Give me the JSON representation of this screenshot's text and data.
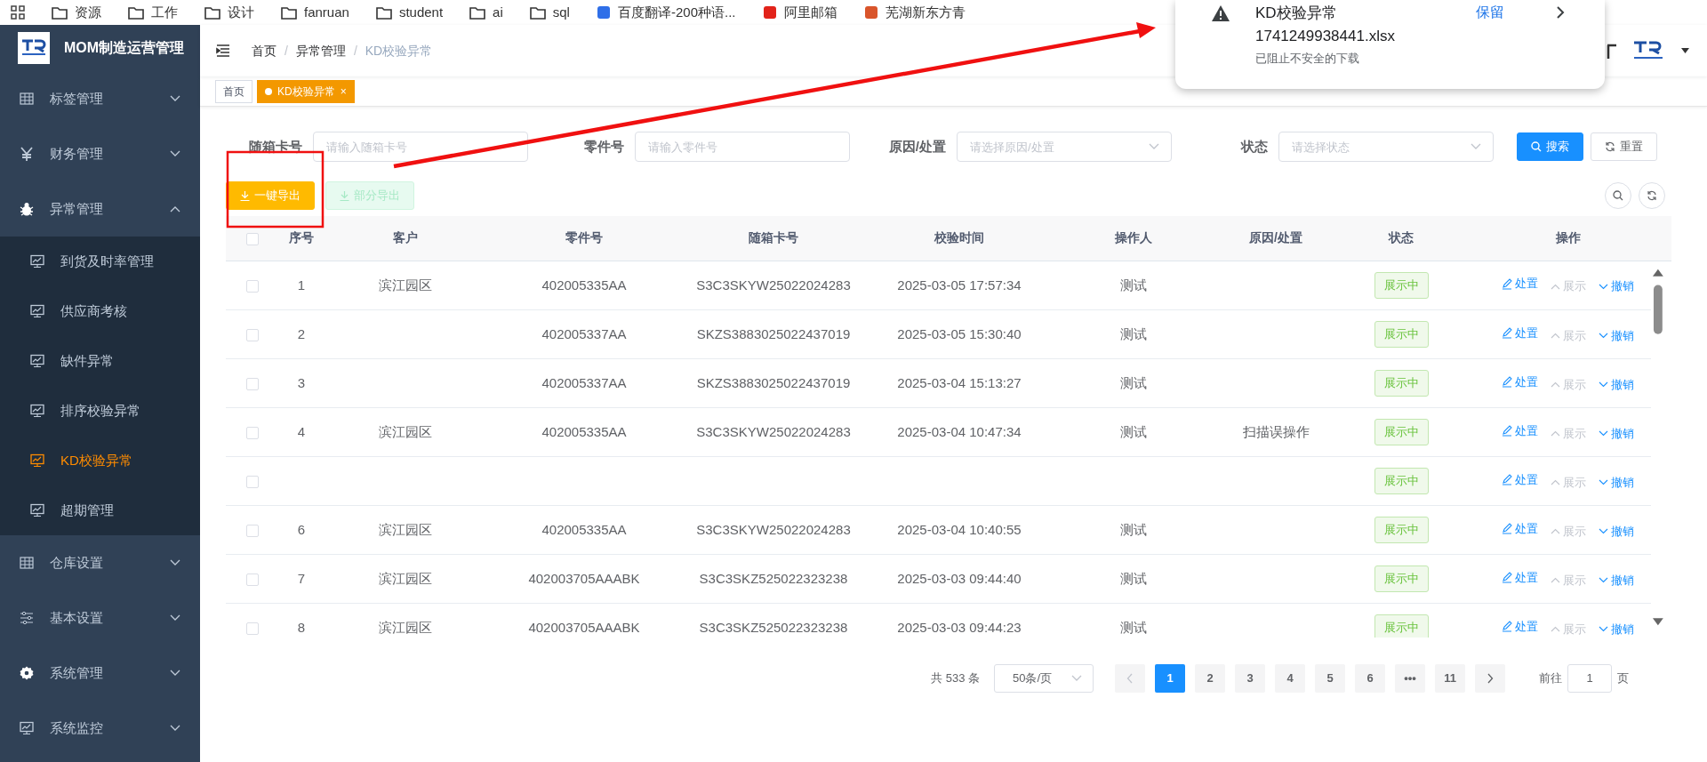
{
  "bookmarks": [
    {
      "label": "资源",
      "kind": "folder"
    },
    {
      "label": "工作",
      "kind": "folder"
    },
    {
      "label": "设计",
      "kind": "folder"
    },
    {
      "label": "fanruan",
      "kind": "folder"
    },
    {
      "label": "student",
      "kind": "folder"
    },
    {
      "label": "ai",
      "kind": "folder"
    },
    {
      "label": "sql",
      "kind": "folder"
    },
    {
      "label": "百度翻译-200种语...",
      "kind": "site",
      "color": "#2f6fe8"
    },
    {
      "label": "阿里邮箱",
      "kind": "site",
      "color": "#e2231a"
    },
    {
      "label": "芜湖新东方青",
      "kind": "site",
      "color": "#d9552b"
    }
  ],
  "download_popup": {
    "title": "KD校验异常",
    "filename": "1741249938441.xlsx",
    "note": "已阻止不安全的下载",
    "action": "保留"
  },
  "sidebar": {
    "title": "MOM制造运营管理",
    "items": [
      {
        "label": "标签管理",
        "expanded": false
      },
      {
        "label": "财务管理",
        "expanded": false
      },
      {
        "label": "异常管理",
        "expanded": true,
        "children": [
          {
            "label": "到货及时率管理",
            "selected": false
          },
          {
            "label": "供应商考核",
            "selected": false
          },
          {
            "label": "缺件异常",
            "selected": false
          },
          {
            "label": "排序校验异常",
            "selected": false
          },
          {
            "label": "KD校验异常",
            "selected": true
          },
          {
            "label": "超期管理",
            "selected": false
          }
        ]
      },
      {
        "label": "仓库设置",
        "expanded": false
      },
      {
        "label": "基本设置",
        "expanded": false
      },
      {
        "label": "系统管理",
        "expanded": false
      },
      {
        "label": "系统监控",
        "expanded": false
      }
    ]
  },
  "breadcrumb": [
    {
      "label": "首页"
    },
    {
      "separator": "/",
      "label": "异常管理"
    },
    {
      "separator": "/",
      "label": "KD校验异常"
    }
  ],
  "tabs": [
    {
      "label": "首页",
      "selected": false
    },
    {
      "label": "KD校验异常",
      "selected": true,
      "close": "×"
    }
  ],
  "filters": [
    {
      "label": "随箱卡号",
      "placeholder": "请输入随箱卡号",
      "kind": "input"
    },
    {
      "label": "零件号",
      "placeholder": "请输入零件号",
      "kind": "input"
    },
    {
      "label": "原因/处置",
      "placeholder": "请选择原因/处置",
      "kind": "select"
    },
    {
      "label": "状态",
      "placeholder": "请选择状态",
      "kind": "select"
    }
  ],
  "search_button": "搜索",
  "reset_button": "重置",
  "export_buttons": [
    {
      "label": "一键导出",
      "disabled": false
    },
    {
      "label": "部分导出",
      "disabled": true
    }
  ],
  "table": {
    "select_all_checked": false,
    "columns": [
      "序号",
      "客户",
      "零件号",
      "随箱卡号",
      "校验时间",
      "操作人",
      "原因/处置",
      "状态",
      "操作"
    ],
    "rows": [
      {
        "checked": false,
        "cells": [
          "1",
          "滨江园区",
          "402005335AA",
          "S3C3SKYW25022024283",
          "2025-03-05 17:57:34",
          "测试",
          "",
          "展示中"
        ],
        "actions": [
          {
            "label": "处置",
            "disabled": false
          },
          {
            "label": "展示",
            "disabled": true
          },
          {
            "label": "撤销",
            "disabled": false
          }
        ]
      },
      {
        "checked": false,
        "cells": [
          "2",
          "",
          "402005337AA",
          "SKZS3883025022437019",
          "2025-03-05 15:30:40",
          "测试",
          "",
          "展示中"
        ],
        "actions": [
          {
            "label": "处置",
            "disabled": false
          },
          {
            "label": "展示",
            "disabled": true
          },
          {
            "label": "撤销",
            "disabled": false
          }
        ]
      },
      {
        "checked": false,
        "cells": [
          "3",
          "",
          "402005337AA",
          "SKZS3883025022437019",
          "2025-03-04 15:13:27",
          "测试",
          "",
          "展示中"
        ],
        "actions": [
          {
            "label": "处置",
            "disabled": false
          },
          {
            "label": "展示",
            "disabled": true
          },
          {
            "label": "撤销",
            "disabled": false
          }
        ]
      },
      {
        "checked": false,
        "cells": [
          "4",
          "滨江园区",
          "402005335AA",
          "S3C3SKYW25022024283",
          "2025-03-04 10:47:34",
          "测试",
          "扫描误操作",
          "展示中"
        ],
        "actions": [
          {
            "label": "处置",
            "disabled": false
          },
          {
            "label": "展示",
            "disabled": true
          },
          {
            "label": "撤销",
            "disabled": false
          }
        ]
      },
      {
        "checked": false,
        "cells": [
          "",
          "",
          "",
          "",
          "",
          "",
          "",
          "展示中"
        ],
        "actions": [
          {
            "label": "处置",
            "disabled": false
          },
          {
            "label": "展示",
            "disabled": true
          },
          {
            "label": "撤销",
            "disabled": false
          }
        ]
      },
      {
        "checked": false,
        "cells": [
          "6",
          "滨江园区",
          "402005335AA",
          "S3C3SKYW25022024283",
          "2025-03-04 10:40:55",
          "测试",
          "",
          "展示中"
        ],
        "actions": [
          {
            "label": "处置",
            "disabled": false
          },
          {
            "label": "展示",
            "disabled": true
          },
          {
            "label": "撤销",
            "disabled": false
          }
        ]
      },
      {
        "checked": false,
        "cells": [
          "7",
          "滨江园区",
          "402003705AAABK",
          "S3C3SKZ525022323238",
          "2025-03-03 09:44:40",
          "测试",
          "",
          "展示中"
        ],
        "actions": [
          {
            "label": "处置",
            "disabled": false
          },
          {
            "label": "展示",
            "disabled": true
          },
          {
            "label": "撤销",
            "disabled": false
          }
        ]
      },
      {
        "checked": false,
        "cells": [
          "8",
          "滨江园区",
          "402003705AAABK",
          "S3C3SKZ525022323238",
          "2025-03-03 09:44:23",
          "测试",
          "",
          "展示中"
        ],
        "actions": [
          {
            "label": "处置",
            "disabled": false
          },
          {
            "label": "展示",
            "disabled": true
          },
          {
            "label": "撤销",
            "disabled": false
          }
        ]
      }
    ]
  },
  "pagination": {
    "total": "共 533 条",
    "page_size": "50条/页",
    "pages": [
      {
        "label": "1",
        "selected": true
      },
      {
        "label": "2",
        "selected": false
      },
      {
        "label": "3",
        "selected": false
      },
      {
        "label": "4",
        "selected": false
      },
      {
        "label": "5",
        "selected": false
      },
      {
        "label": "6",
        "selected": false
      },
      {
        "label": "•••",
        "selected": false
      },
      {
        "label": "11",
        "selected": false
      }
    ],
    "goto_label": "前往",
    "goto_value": "1",
    "page_unit": "页"
  }
}
